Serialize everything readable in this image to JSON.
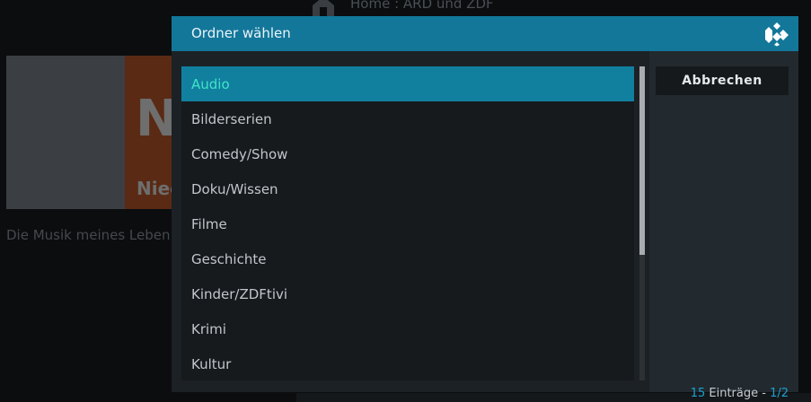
{
  "background": {
    "breadcrumb": "Home : ARD und ZDF",
    "thumbnail_mark": "N",
    "thumbnail_text": "Niec",
    "caption": "Die Musik meines Leben"
  },
  "dialog": {
    "title": "Ordner wählen",
    "items": [
      {
        "label": "Audio",
        "selected": true
      },
      {
        "label": "Bilderserien"
      },
      {
        "label": "Comedy/Show"
      },
      {
        "label": "Doku/Wissen"
      },
      {
        "label": "Filme"
      },
      {
        "label": "Geschichte"
      },
      {
        "label": "Kinder/ZDFtivi"
      },
      {
        "label": "Krimi"
      },
      {
        "label": "Kultur"
      }
    ],
    "cancel_label": "Abbrechen",
    "entries": {
      "count": "15",
      "label": " Einträge - ",
      "page": "1/2"
    },
    "scroll_fraction": 0.6
  },
  "colors": {
    "accent": "#13779a",
    "selected_bg": "#11809f",
    "selected_text": "#3fe4c9"
  },
  "icons": {
    "logo": "kodi-logo-icon",
    "home": "home-icon"
  }
}
